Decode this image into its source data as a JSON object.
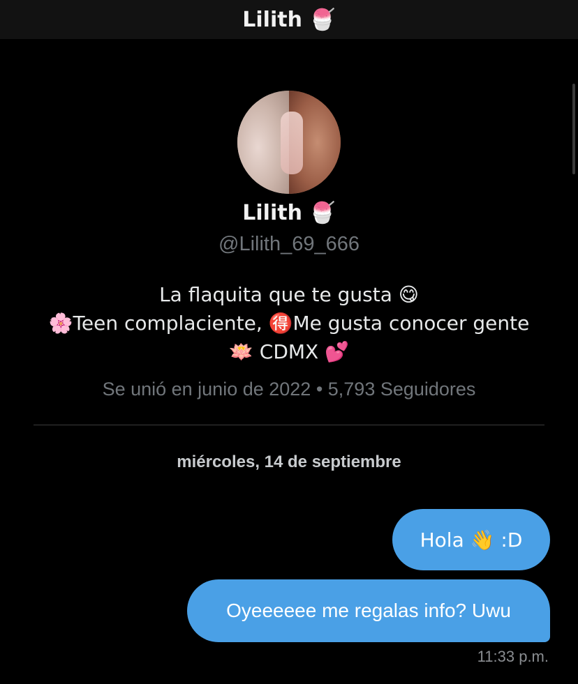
{
  "header": {
    "title": "Lilith 🍧"
  },
  "profile": {
    "name": "Lilith 🍧",
    "handle": "@Lilith_69_666",
    "bio": {
      "line1": "La flaquita que te gusta 😋",
      "line2": "🌸Teen complaciente, 🉐Me gusta conocer gente",
      "line3": "🪷 CDMX 💕"
    },
    "meta": "Se unió en junio de 2022 • 5,793 Seguidores"
  },
  "conversation": {
    "date_separator": "miércoles, 14 de septiembre",
    "messages": [
      {
        "text": "Hola 👋 :D",
        "sender": "me"
      },
      {
        "text": "Oyeeeeee me regalas info? Uwu",
        "sender": "me"
      }
    ],
    "timestamp": "11:33 p.m."
  },
  "colors": {
    "background": "#000000",
    "bubble": "#4aa0e6",
    "secondary_text": "#71767b"
  }
}
